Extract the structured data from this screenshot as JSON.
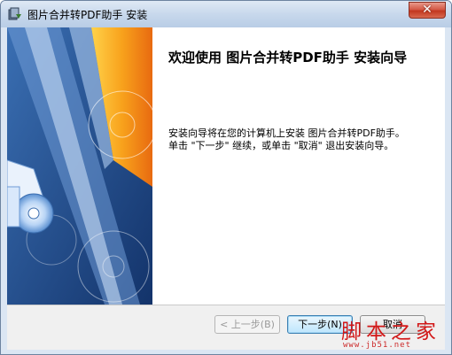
{
  "window": {
    "title": "图片合并转PDF助手 安装",
    "close_glyph": "✕"
  },
  "content": {
    "welcome_title": "欢迎使用 图片合并转PDF助手 安装向导",
    "description_line1": "安装向导将在您的计算机上安装 图片合并转PDF助手。",
    "description_line2": "单击 \"下一步\" 继续，或单击 \"取消\" 退出安装向导。"
  },
  "footer": {
    "back_label": "< 上一步(B)",
    "next_label": "下一步(N)",
    "cancel_label": "取消"
  },
  "watermark": {
    "text": "脚本之家",
    "url": "www.jb51.net"
  },
  "colors": {
    "banner_blue": "#1d4b8c",
    "banner_orange": "#f5a623",
    "close_red": "#c2371f",
    "watermark_red": "#d21818"
  }
}
